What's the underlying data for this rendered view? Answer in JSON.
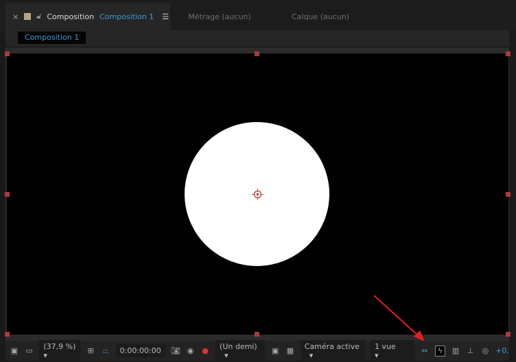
{
  "tabs": {
    "active": {
      "close": "×",
      "label": "Composition",
      "name": "Composition 1",
      "menu": "☰"
    },
    "footage": "Métrage  (aucun)",
    "layer": "Calque  (aucun)"
  },
  "subtab": "Composition 1",
  "toolbar": {
    "zoom": "(37,9 %)",
    "timecode": "0:00:00:00",
    "resolution": "(Un demi)",
    "camera": "Caméra active",
    "views": "1 vue",
    "exposure": "+0,"
  },
  "colors": {
    "accent": "#3d9bd6",
    "handle": "#b03a3a",
    "arrow": "#e02020"
  }
}
